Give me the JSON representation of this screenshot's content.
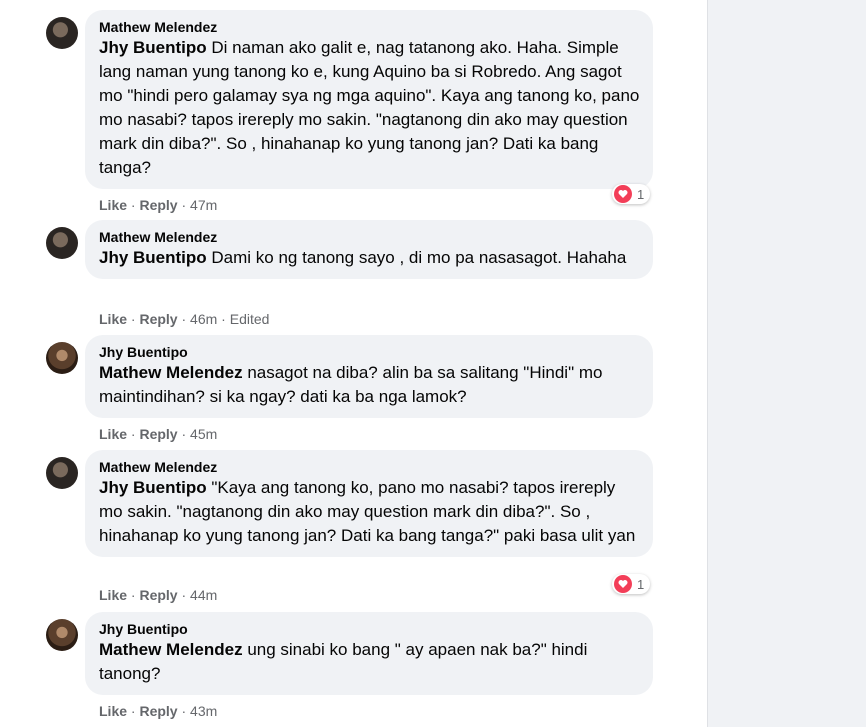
{
  "comments": [
    {
      "author": "Mathew Melendez",
      "mention": "Jhy Buentipo",
      "text": " Di naman ako galit e, nag tatanong ako. Haha. Simple lang naman yung tanong ko e, kung Aquino ba si Robredo. Ang sagot mo \"hindi pero galamay sya ng mga aquino\". Kaya ang tanong ko, pano mo nasabi? tapos irereply mo sakin. \"nagtanong din ako may question mark din diba?\". So , hinahanap ko yung tanong jan? Dati ka bang tanga?",
      "like": "Like",
      "reply": "Reply",
      "time": "47m",
      "edited": "",
      "reactions": "1"
    },
    {
      "author": "Mathew Melendez",
      "mention": "Jhy Buentipo",
      "text": " Dami ko ng tanong sayo , di mo pa nasasagot. Hahaha",
      "like": "Like",
      "reply": "Reply",
      "time": "46m",
      "edited": "Edited",
      "reactions": ""
    },
    {
      "author": "Jhy Buentipo",
      "mention": "Mathew Melendez",
      "text": " nasagot na diba? alin ba sa salitang \"Hindi\" mo maintindihan? si ka ngay? dati ka ba nga lamok?",
      "like": "Like",
      "reply": "Reply",
      "time": "45m",
      "edited": "",
      "reactions": ""
    },
    {
      "author": "Mathew Melendez",
      "mention": "Jhy Buentipo",
      "text": " \"Kaya ang tanong ko, pano mo nasabi? tapos irereply mo sakin. \"nagtanong din ako may question mark din diba?\". So , hinahanap ko yung tanong jan? Dati ka bang tanga?\" paki basa ulit yan",
      "like": "Like",
      "reply": "Reply",
      "time": "44m",
      "edited": "",
      "reactions": "1"
    },
    {
      "author": "Jhy Buentipo",
      "mention": "Mathew Melendez",
      "text": " ung sinabi ko bang \" ay apaen nak ba?\" hindi tanong?",
      "like": "Like",
      "reply": "Reply",
      "time": "43m",
      "edited": "",
      "reactions": ""
    }
  ],
  "colors": {
    "reaction_heart": "#f33e58",
    "bubble": "#f0f2f5",
    "meta": "#65676b"
  }
}
